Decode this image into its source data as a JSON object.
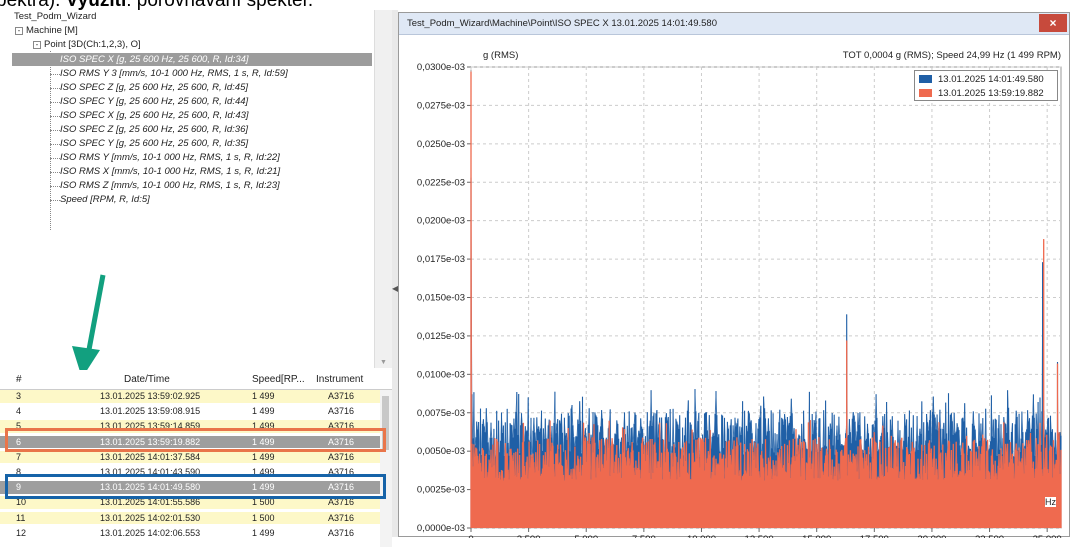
{
  "doc": {
    "prefix": "pektra). ",
    "bold": "Využití",
    "rest": ": porovnávání spekter."
  },
  "tree": {
    "root": "Test_Podm_Wizard",
    "machine": "Machine [M]",
    "point": "Point [3D(Ch:1,2,3), O]",
    "items": [
      "ISO SPEC X [g, 25 600 Hz, 25 600, R, Id:34]",
      "ISO RMS Y 3 [mm/s, 10-1 000 Hz, RMS, 1 s, R, Id:59]",
      "ISO SPEC Z [g, 25 600 Hz, 25 600, R, Id:45]",
      "ISO SPEC Y [g, 25 600 Hz, 25 600, R, Id:44]",
      "ISO SPEC X [g, 25 600 Hz, 25 600, R, Id:43]",
      "ISO SPEC Z [g, 25 600 Hz, 25 600, R, Id:36]",
      "ISO SPEC Y [g, 25 600 Hz, 25 600, R, Id:35]",
      "ISO RMS Y [mm/s, 10-1 000 Hz, RMS, 1 s, R, Id:22]",
      "ISO RMS X [mm/s, 10-1 000 Hz, RMS, 1 s, R, Id:21]",
      "ISO RMS Z [mm/s, 10-1 000 Hz, RMS, 1 s, R, Id:23]",
      "Speed [RPM, R, Id:5]"
    ]
  },
  "grid": {
    "headers": [
      "#",
      "Date/Time",
      "Speed[RP...",
      "Instrument"
    ],
    "rows": [
      {
        "n": "3",
        "dt": "13.01.2025 13:59:02.925",
        "sp": "1 499",
        "ins": "A3716",
        "style": "y"
      },
      {
        "n": "4",
        "dt": "13.01.2025 13:59:08.915",
        "sp": "1 499",
        "ins": "A3716",
        "style": "w"
      },
      {
        "n": "5",
        "dt": "13.01.2025 13:59:14.859",
        "sp": "1 499",
        "ins": "A3716",
        "style": "y"
      },
      {
        "n": "6",
        "dt": "13.01.2025 13:59:19.882",
        "sp": "1 499",
        "ins": "A3716",
        "style": "g"
      },
      {
        "n": "7",
        "dt": "13.01.2025 14:01:37.584",
        "sp": "1 499",
        "ins": "A3716",
        "style": "y"
      },
      {
        "n": "8",
        "dt": "13.01.2025 14:01:43.590",
        "sp": "1 499",
        "ins": "A3716",
        "style": "w"
      },
      {
        "n": "9",
        "dt": "13.01.2025 14:01:49.580",
        "sp": "1 499",
        "ins": "A3716",
        "style": "g"
      },
      {
        "n": "10",
        "dt": "13.01.2025 14:01:55.586",
        "sp": "1 500",
        "ins": "A3716",
        "style": "y"
      },
      {
        "n": "11",
        "dt": "13.01.2025 14:02:01.530",
        "sp": "1 500",
        "ins": "A3716",
        "style": "y"
      },
      {
        "n": "12",
        "dt": "13.01.2025 14:02:06.553",
        "sp": "1 499",
        "ins": "A3716",
        "style": "w"
      }
    ]
  },
  "window": {
    "title": "Test_Podm_Wizard\\Machine\\Point\\ISO SPEC X    13.01.2025 14:01:49.580",
    "close_icon": "×"
  },
  "colors": {
    "series_blue": "#1f5fa6",
    "series_red": "#ef6a4f",
    "annot_red": "#e9754a",
    "annot_blue": "#1663a8",
    "arrow": "#12a07f"
  },
  "chart_data": {
    "type": "line",
    "y_unit_label": "g (RMS)",
    "info": "TOT 0,0004 g (RMS); Speed 24,99 Hz (1 499 RPM)",
    "x_unit": "Hz",
    "xlim": [
      0,
      25600
    ],
    "ylim": [
      0,
      3e-05
    ],
    "y_ticks": [
      "0,0000e-03",
      "0,0025e-03",
      "0,0050e-03",
      "0,0075e-03",
      "0,0100e-03",
      "0,0125e-03",
      "0,0150e-03",
      "0,0175e-03",
      "0,0200e-03",
      "0,0225e-03",
      "0,0250e-03",
      "0,0275e-03",
      "0,0300e-03"
    ],
    "x_ticks": [
      "0",
      "2 500",
      "5 000",
      "7 500",
      "10 000",
      "12 500",
      "15 000",
      "17 500",
      "20 000",
      "22 500",
      "25 000"
    ],
    "series": [
      {
        "name": "13.01.2025 14:01:49.580",
        "color": "#1f5fa6",
        "baseline": 6.2e-06,
        "noise": 1.6e-06,
        "peaks": [
          [
            0,
            2.28e-05
          ],
          [
            16300,
            1.39e-05
          ],
          [
            24800,
            1.73e-05
          ],
          [
            25450,
            1.08e-05
          ]
        ]
      },
      {
        "name": "13.01.2025 13:59:19.882",
        "color": "#ef6a4f",
        "baseline": 4.5e-06,
        "noise": 1.4e-06,
        "peaks": [
          [
            0,
            2.97e-05
          ],
          [
            16300,
            1.22e-05
          ],
          [
            24850,
            1.88e-05
          ],
          [
            25450,
            1.07e-05
          ]
        ]
      }
    ]
  }
}
